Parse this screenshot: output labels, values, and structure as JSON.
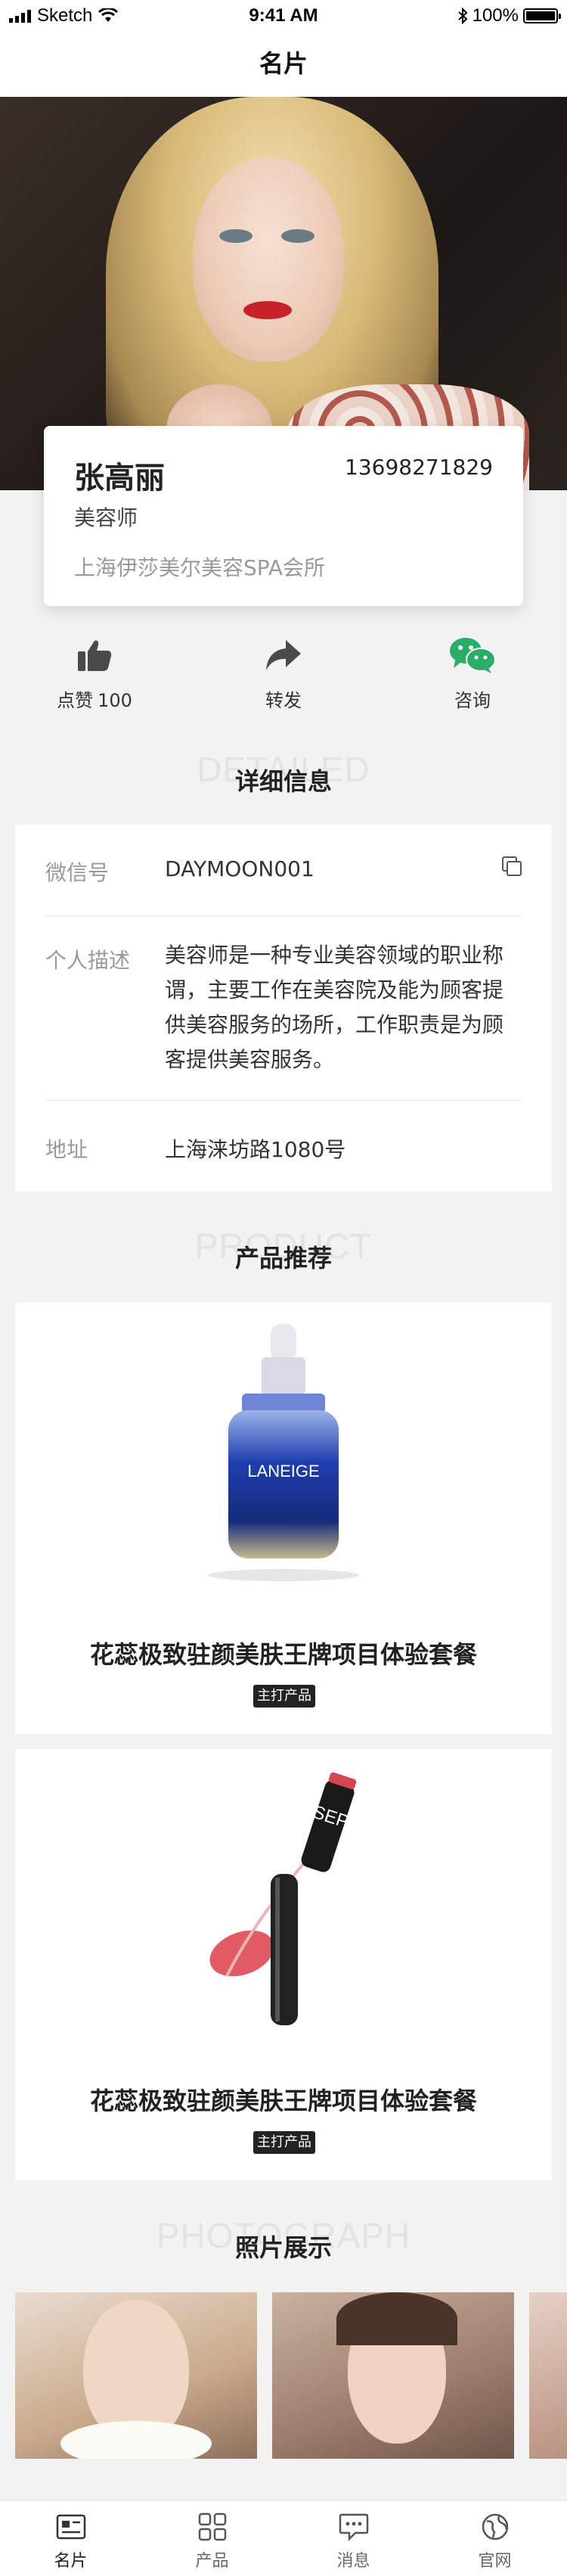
{
  "status_bar": {
    "carrier": "Sketch",
    "time": "9:41 AM",
    "battery": "100%"
  },
  "nav": {
    "title": "名片"
  },
  "card": {
    "name": "张高丽",
    "phone": "13698271829",
    "title": "美容师",
    "company": "上海伊莎美尔美容SPA会所"
  },
  "actions": [
    {
      "label": "点赞",
      "count": "100",
      "icon": "thumbs-up-icon"
    },
    {
      "label": "转发",
      "icon": "share-arrow-icon"
    },
    {
      "label": "咨询",
      "icon": "wechat-icon"
    }
  ],
  "details_section": {
    "bg_text": "DETAILED",
    "title": "详细信息"
  },
  "details": {
    "wechat": {
      "label": "微信号",
      "value": "DAYMOON001"
    },
    "desc": {
      "label": "个人描述",
      "lines": [
        "美容师是一种专业美容领域的职业称",
        "谓，主要工作在美容院及能为顾客提",
        "供美容服务的场所，工作职责是为顾",
        "客提供美容服务。"
      ]
    },
    "address": {
      "label": "地址",
      "value": "上海涞坊路1080号"
    }
  },
  "product_section": {
    "bg_text": "PRODUCT",
    "title": "产品推荐"
  },
  "products": [
    {
      "name": "花蕊极致驻颜美肤王牌项目体验套餐",
      "badge": "主打产品",
      "bottle_text": "LANEIGE"
    },
    {
      "name": "花蕊极致驻颜美肤王牌项目体验套餐",
      "badge": "主打产品",
      "tube_text": "SEP"
    }
  ],
  "photo_section": {
    "bg_text": "PHOTOGRAPH",
    "title": "照片展示"
  },
  "tabs": [
    {
      "label": "名片",
      "icon": "card-icon",
      "active": true
    },
    {
      "label": "产品",
      "icon": "grid-icon"
    },
    {
      "label": "消息",
      "icon": "message-icon"
    },
    {
      "label": "官网",
      "icon": "globe-icon"
    }
  ],
  "colors": {
    "accent_green": "#2aae67",
    "text_dark": "#222222",
    "muted": "#999999",
    "background": "#f2f2f2"
  }
}
